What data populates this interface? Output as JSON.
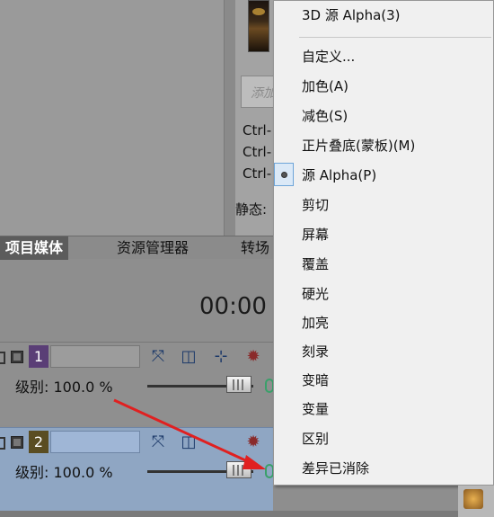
{
  "info_panel": {
    "add_placeholder": "添加",
    "shortcuts": [
      "Ctrl-",
      "Ctrl-",
      "Ctrl-"
    ],
    "static_label": "静态:"
  },
  "tabs": [
    {
      "label": "项目媒体",
      "active": true
    },
    {
      "label": "资源管理器",
      "active": false
    },
    {
      "label": "转场",
      "active": false
    }
  ],
  "timeline": {
    "timecode": "00:00"
  },
  "tracks": [
    {
      "number": "1",
      "level_label": "级别: 100.0 %",
      "level_value": 100.0,
      "color": "#5a3e76"
    },
    {
      "number": "2",
      "level_label": "级别: 100.0 %",
      "level_value": 100.0,
      "color": "#5a4d22"
    }
  ],
  "menu": {
    "top_item": "3D 源 Alpha(3)",
    "items": [
      {
        "label": "自定义..."
      },
      {
        "label": "加色(A)"
      },
      {
        "label": "减色(S)"
      },
      {
        "label": "正片叠底(蒙板)(M)"
      },
      {
        "label": "源 Alpha(P)",
        "selected": true
      },
      {
        "label": "剪切"
      },
      {
        "label": "屏幕"
      },
      {
        "label": "覆盖"
      },
      {
        "label": "硬光"
      },
      {
        "label": "加亮"
      },
      {
        "label": "刻录"
      },
      {
        "label": "变暗"
      },
      {
        "label": "变量"
      },
      {
        "label": "区别"
      },
      {
        "label": "差异已消除"
      }
    ]
  },
  "colors": {
    "menu_bg": "#f0f0f0",
    "selected_track_bg": "#8fa6c3",
    "annotation_arrow": "#e02020",
    "radio_highlight": "#6ea5d8"
  },
  "icons": [
    "composite-mode-icon",
    "parent-composite-icon",
    "motion-icon",
    "track-fx-icon"
  ]
}
